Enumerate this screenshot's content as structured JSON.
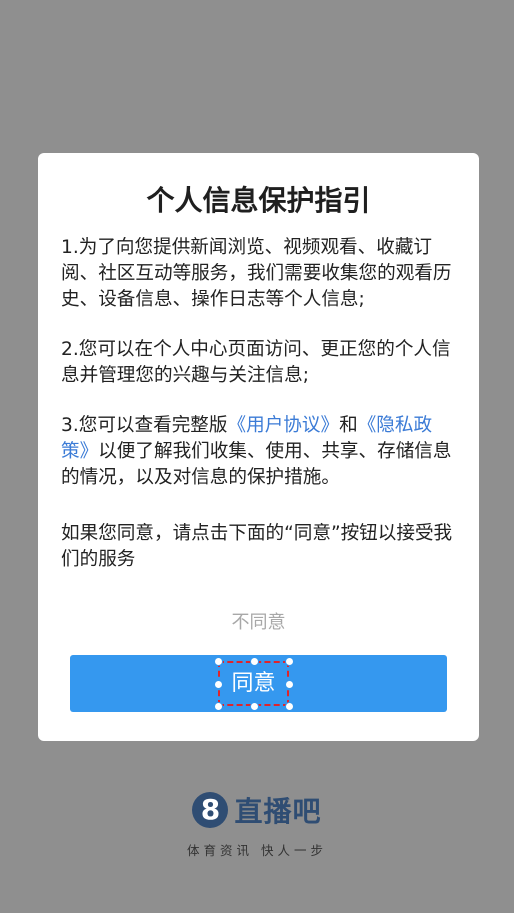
{
  "dialog": {
    "title": "个人信息保护指引",
    "para1": "1.为了向您提供新闻浏览、视频观看、收藏订阅、社区互动等服务，我们需要收集您的观看历史、设备信息、操作日志等个人信息;",
    "para2": "2.您可以在个人中心页面访问、更正您的个人信息并管理您的兴趣与关注信息;",
    "para3_prefix": "3.您可以查看完整版",
    "user_agreement_link": "《用户协议》",
    "para3_and": "和",
    "privacy_policy_link": "《隐私政策》",
    "para3_suffix": "以便了解我们收集、使用、共享、存储信息的情况，以及对信息的保护措施。",
    "consent": "如果您同意，请点击下面的“同意”按钮以接受我们的服务",
    "disagree_label": "不同意",
    "agree_label": "同意"
  },
  "brand": {
    "logo_glyph": "8",
    "name": "直播吧",
    "slogan": "体育资讯  快人一步"
  },
  "colors": {
    "backdrop": "#8f8f8f",
    "accent": "#3598ef",
    "link": "#3b7bd6",
    "brand": "#2f4d73",
    "selection": "#e0242b"
  }
}
